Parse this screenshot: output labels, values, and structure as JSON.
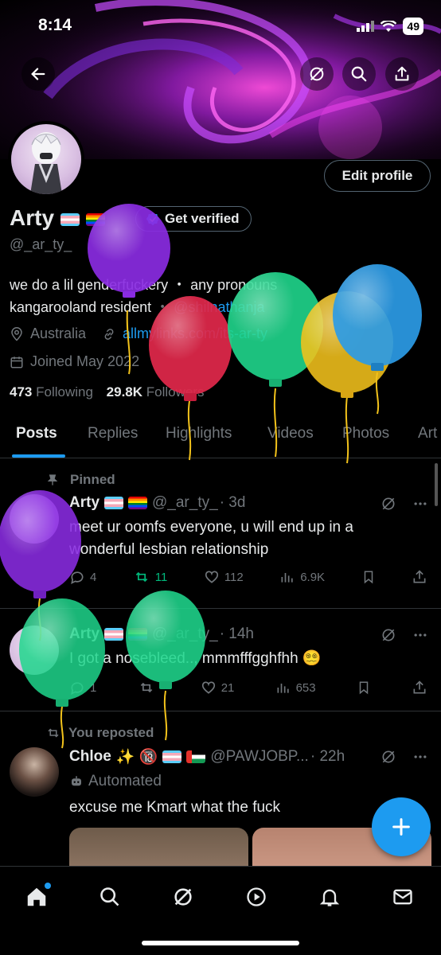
{
  "status": {
    "time": "8:14",
    "battery": "49"
  },
  "profile": {
    "name": "Arty",
    "handle": "@_ar_ty_",
    "edit_label": "Edit profile",
    "verify_label": "Get verified",
    "bio_line1_a": "we do a lil genderfuckery",
    "bio_line1_sep": "・",
    "bio_line1_b": "any pronouns",
    "bio_line2_a": "kangarooland resident",
    "bio_line2_sep": "・",
    "bio_line2_mention": "@shilnathanja",
    "location": "Australia",
    "link": "allmylinks.com/its-ar-ty",
    "joined": "Joined May 2022",
    "following_count": "473",
    "following_label": "Following",
    "followers_count": "29.8K",
    "followers_label": "Followers"
  },
  "tabs": [
    "Posts",
    "Replies",
    "Highlights",
    "Videos",
    "Photos",
    "Art"
  ],
  "posts": [
    {
      "label": "Pinned",
      "name": "Arty",
      "handle": "@_ar_ty_",
      "time": "· 3d",
      "text": "meet ur oomfs everyone, u will end up in a wonderful lesbian relationship",
      "replies": "4",
      "reposts": "11",
      "likes": "112",
      "views": "6.9K"
    },
    {
      "name": "Arty",
      "handle": "@_ar_ty_",
      "time": "· 14h",
      "text": "I got a nosebleed.., mmmfffgghfhh 😵‍💫",
      "replies": "1",
      "reposts": "",
      "likes": "21",
      "views": "653"
    },
    {
      "label": "You reposted",
      "name": "Chloe",
      "name_extra": "✨ 🔞",
      "handle": "@PAWJOBP...",
      "time": "· 22h",
      "automated": "Automated",
      "text": "excuse me Kmart what the fuck"
    }
  ],
  "colors": {
    "accent": "#1d9bf0",
    "repost_green": "#00ba7c",
    "muted": "#71767b",
    "balloon_purple": "#8a2be2",
    "balloon_red": "#e0284a",
    "balloon_green": "#1fd68c",
    "balloon_yellow": "#f2c21b",
    "balloon_blue": "#2b9be6"
  },
  "icons": [
    "back-arrow-icon",
    "grok-icon",
    "search-icon",
    "share-icon",
    "location-icon",
    "link-icon",
    "calendar-icon",
    "pin-icon",
    "reply-icon",
    "repost-icon",
    "like-icon",
    "views-icon",
    "bookmark-icon",
    "more-icon",
    "home-icon",
    "notifications-icon",
    "messages-icon",
    "video-icon",
    "plus-icon"
  ]
}
